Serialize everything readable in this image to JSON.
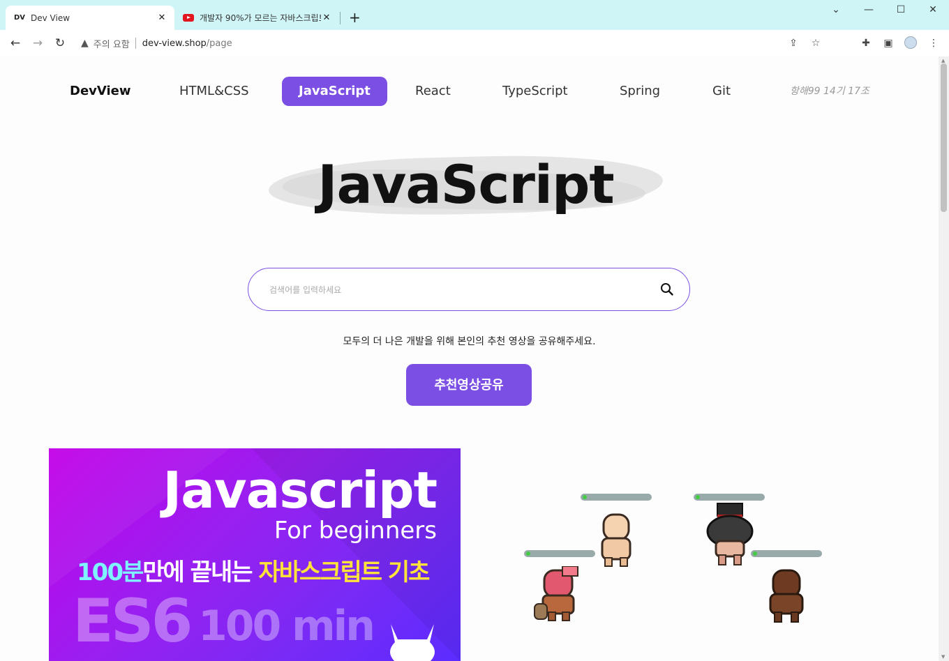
{
  "browser": {
    "tabs": [
      {
        "favicon": "DV",
        "title": "Dev View",
        "active": true
      },
      {
        "favicon": "youtube-icon",
        "title": "개발자 90%가 모르는 자바스크립트",
        "active": false
      }
    ],
    "address": {
      "security_label": "주의 요함",
      "host": "dev-view.shop",
      "path": "/page"
    }
  },
  "nav": {
    "brand": "DevView",
    "items": [
      "HTML&CSS",
      "JavaScript",
      "React",
      "TypeScript",
      "Spring",
      "Git"
    ],
    "active": "JavaScript",
    "credit": "항해99 14기 17조"
  },
  "hero": {
    "title": "JavaScript"
  },
  "search": {
    "placeholder": "검색어를 입력하세요",
    "value": ""
  },
  "description": "모두의 더 나은 개발을 위해 본인의 추천 영상을 공유해주세요.",
  "share_button": "추천영상공유",
  "thumbnail": {
    "title": "Javascript",
    "subtitle": "For beginners",
    "tagline_a": "100분",
    "tagline_b": "만에 끝내는 ",
    "tagline_c": "자바스크립트 기초",
    "big_a": "ES6",
    "big_b": "100 min"
  },
  "colors": {
    "accent": "#7b4ee4",
    "tabstrip": "#cff5f7"
  }
}
